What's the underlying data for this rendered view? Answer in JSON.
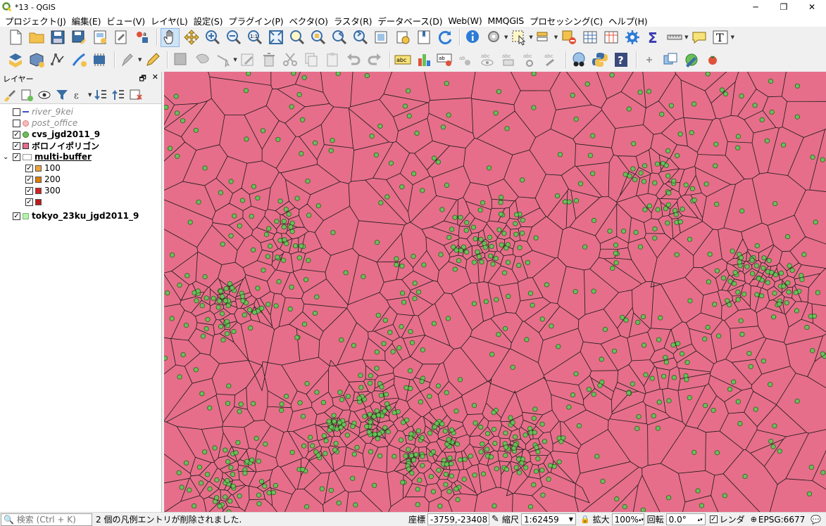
{
  "window": {
    "title": "*13 - QGIS",
    "minimize": "─",
    "restore": "❐",
    "close": "✕"
  },
  "menu": [
    "プロジェクト(J)",
    "編集(E)",
    "ビュー(V)",
    "レイヤ(L)",
    "設定(S)",
    "プラグイン(P)",
    "ベクタ(O)",
    "ラスタ(R)",
    "データベース(D)",
    "Web(W)",
    "MMQGIS",
    "プロセッシング(C)",
    "ヘルプ(H)"
  ],
  "layers_panel": {
    "title": "レイヤー",
    "float_btn": "🗗",
    "close_btn": "✕",
    "layers": [
      {
        "name": "river_9kei",
        "checked": false,
        "symbol": "line",
        "color": "#3a4fd0",
        "style": "gray"
      },
      {
        "name": "post_office",
        "checked": false,
        "symbol": "point",
        "color": "#e87b7b",
        "style": "gray"
      },
      {
        "name": "cvs_jgd2011_9",
        "checked": true,
        "symbol": "point",
        "color": "#6bbf59",
        "style": "bold"
      },
      {
        "name": "ボロノイポリゴン",
        "checked": true,
        "symbol": "fill",
        "color": "#e66e8a",
        "style": "bold"
      },
      {
        "name": "multi-buffer",
        "checked": true,
        "symbol": "group",
        "color": "#ffffff",
        "style": "bold-underline",
        "expanded": true,
        "classes": [
          {
            "label": "100",
            "checked": true,
            "color": "#f0a23c"
          },
          {
            "label": "200",
            "checked": true,
            "color": "#e07b00"
          },
          {
            "label": "300",
            "checked": true,
            "color": "#d42020"
          },
          {
            "label": "",
            "checked": true,
            "color": "#c01818"
          }
        ]
      },
      {
        "name": "tokyo_23ku_jgd2011_9",
        "checked": true,
        "symbol": "fill",
        "color": "#b9f0b0",
        "style": "bold"
      }
    ]
  },
  "map": {
    "fill_color": "#e66e8a",
    "edge_color": "#1a1a1a",
    "point_color": "#6bbf59"
  },
  "statusbar": {
    "search_placeholder": "🔍 検索 (Ctrl + K)",
    "message": "2 個の凡例エントリが削除されました.",
    "coord_label": "座標",
    "coord_value": "-3759,-23408",
    "scale_label": "縮尺",
    "scale_value": "1:62459",
    "magnifier_label": "拡大",
    "magnifier_value": "100%",
    "rotation_label": "回転",
    "rotation_value": "0.0°",
    "render_label": "レンダ",
    "crs": "EPSG:6677"
  }
}
